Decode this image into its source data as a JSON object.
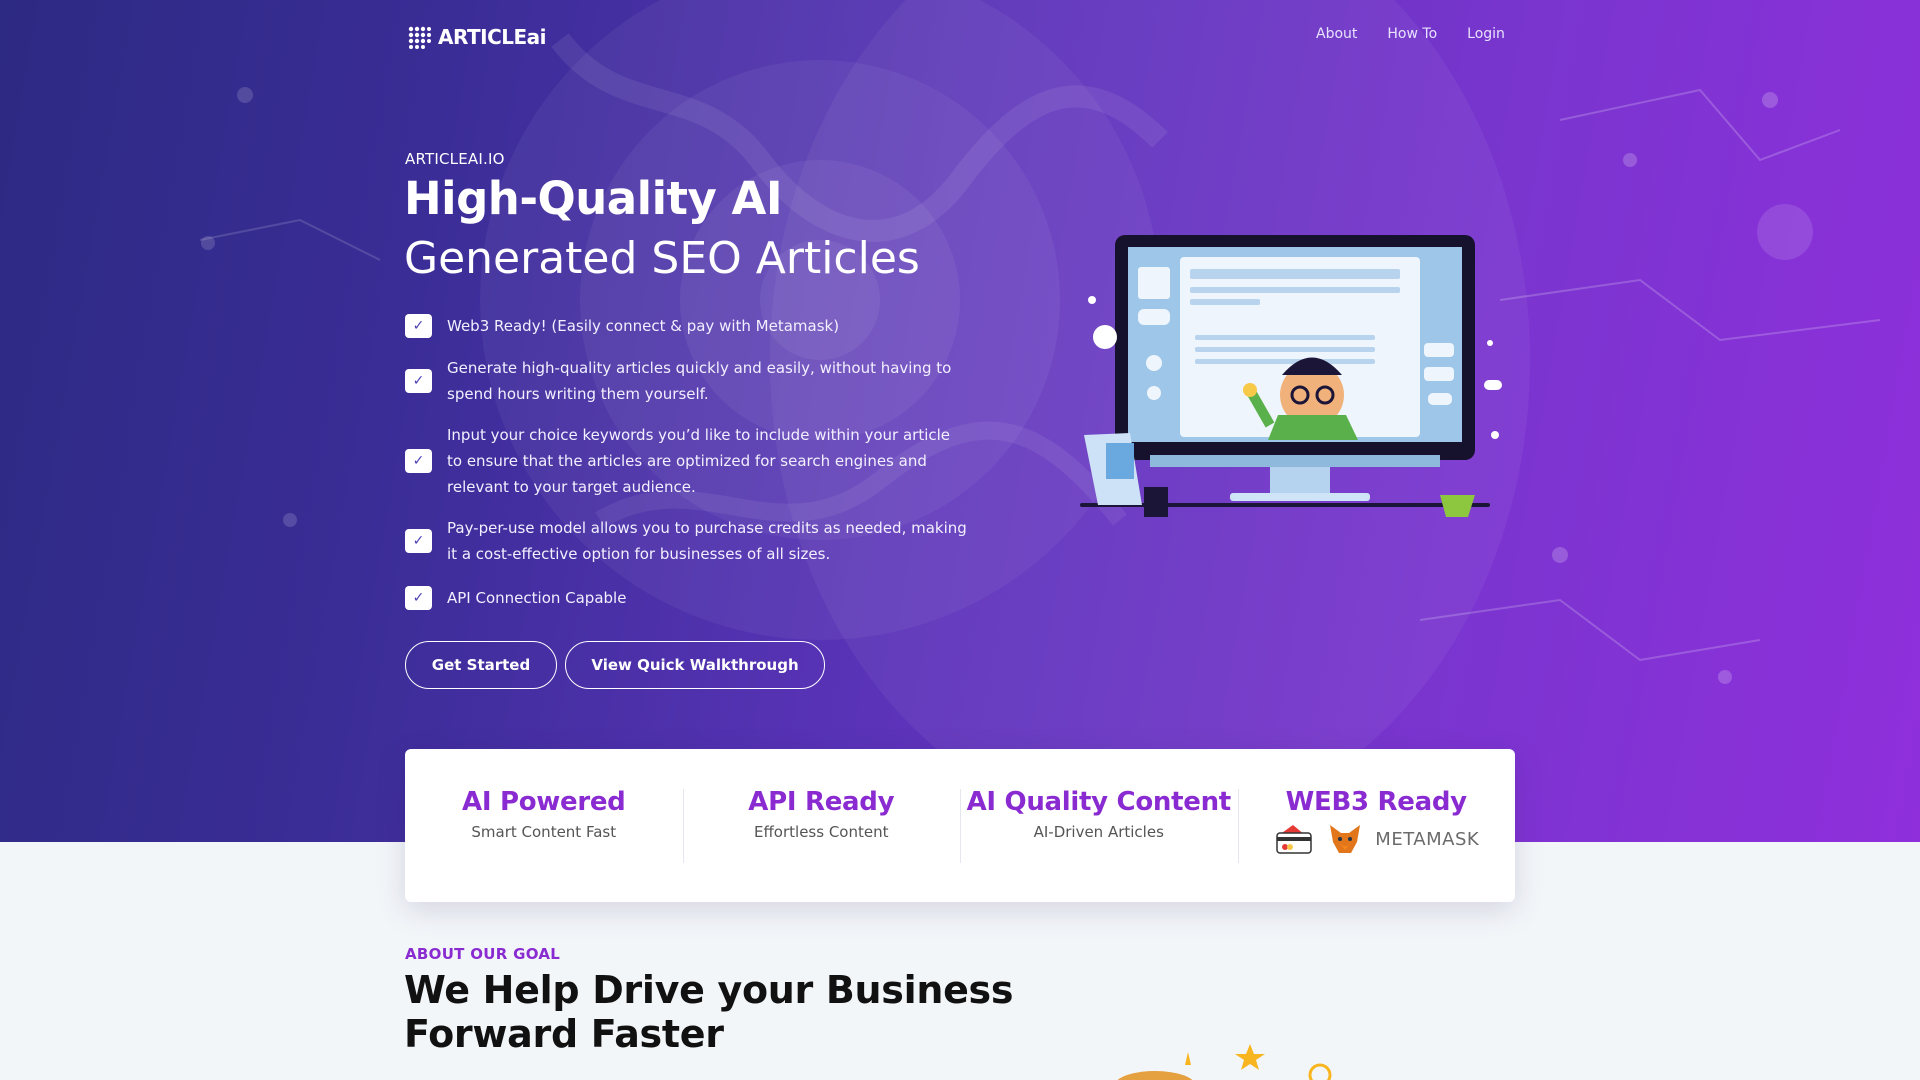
{
  "brand": {
    "name": "ARTICLEai"
  },
  "nav": {
    "items": [
      "About",
      "How To",
      "Login"
    ]
  },
  "hero": {
    "eyebrow": "ARTICLEAI.IO",
    "title_bold": "High-Quality AI",
    "title_light": "Generated SEO Articles",
    "features": [
      "Web3 Ready! (Easily connect & pay with Metamask)",
      "Generate high-quality articles quickly and easily, without having to spend hours writing them yourself.",
      "Input your choice keywords you’d like to include within your article to ensure that the articles are optimized for search engines and relevant to your target audience.",
      "Pay-per-use model allows you to purchase credits as needed, making it a cost-effective option for businesses of all sizes.",
      "API Connection Capable"
    ],
    "check_glyph": "✓",
    "buttons": {
      "primary": "Get Started",
      "secondary": "View Quick Walkthrough"
    }
  },
  "stats": [
    {
      "title": "AI Powered",
      "subtitle": "Smart Content Fast"
    },
    {
      "title": "API Ready",
      "subtitle": "Effortless Content"
    },
    {
      "title": "AI Quality Content",
      "subtitle": "AI-Driven Articles"
    },
    {
      "title": "WEB3 Ready",
      "subtitle": "METAMASK"
    }
  ],
  "about": {
    "eyebrow": "ABOUT OUR GOAL",
    "title": "We Help Drive your Business Forward Faster"
  },
  "colors": {
    "accent": "#8a2bd2",
    "hero_start": "#2d2a83",
    "hero_end": "#8f2fdc",
    "page_bg": "#f3f6f9"
  },
  "icons": [
    "brand-logo-icon",
    "check-icon",
    "credit-card-icon",
    "metamask-fox-icon",
    "star-icon"
  ]
}
